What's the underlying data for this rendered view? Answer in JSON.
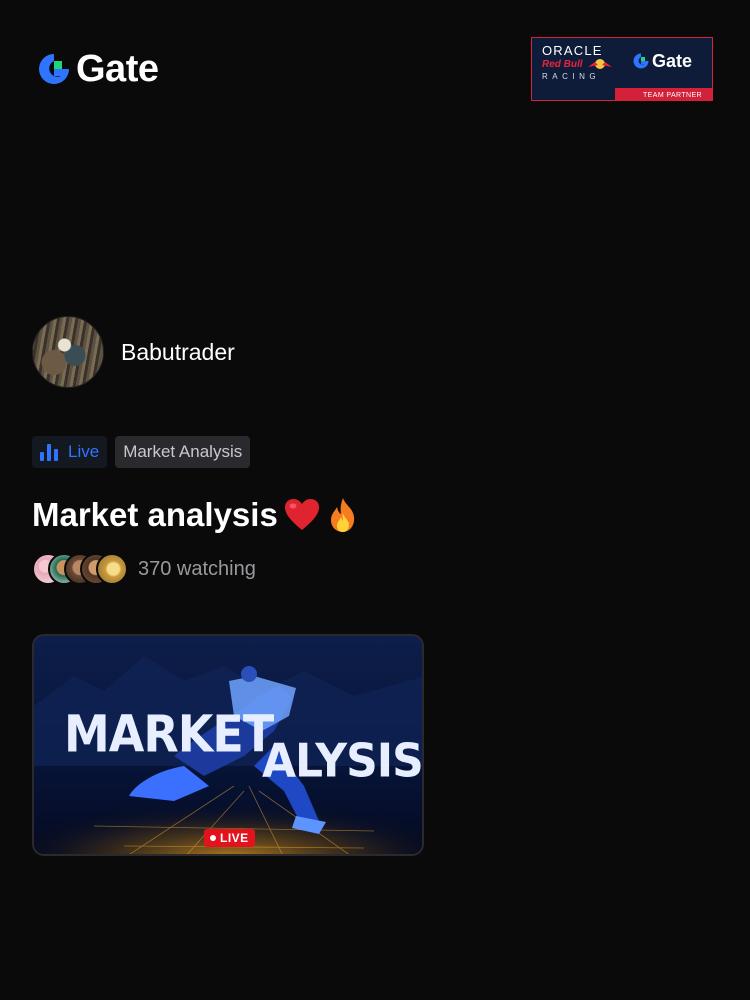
{
  "header": {
    "logo_text": "Gate",
    "partner_badge": {
      "oracle": "ORACLE",
      "redbull": "Red Bull",
      "racing": "RACING",
      "gate_text": "Gate",
      "team_partner": "TEAM PARTNER"
    }
  },
  "host": {
    "name": "Babutrader"
  },
  "tags": {
    "live_label": "Live",
    "category": "Market Analysis"
  },
  "stream": {
    "title": "Market analysis",
    "title_emojis": [
      "heart",
      "fire"
    ],
    "watching": "370 watching",
    "thumbnail": {
      "line1": "MARKET",
      "line2": "ALYSIS",
      "live_badge": "LIVE"
    }
  },
  "colors": {
    "background": "#0a0a0a",
    "accent_blue": "#2f74ff",
    "live_red": "#e3121d",
    "muted_text": "#9a9a9e"
  }
}
